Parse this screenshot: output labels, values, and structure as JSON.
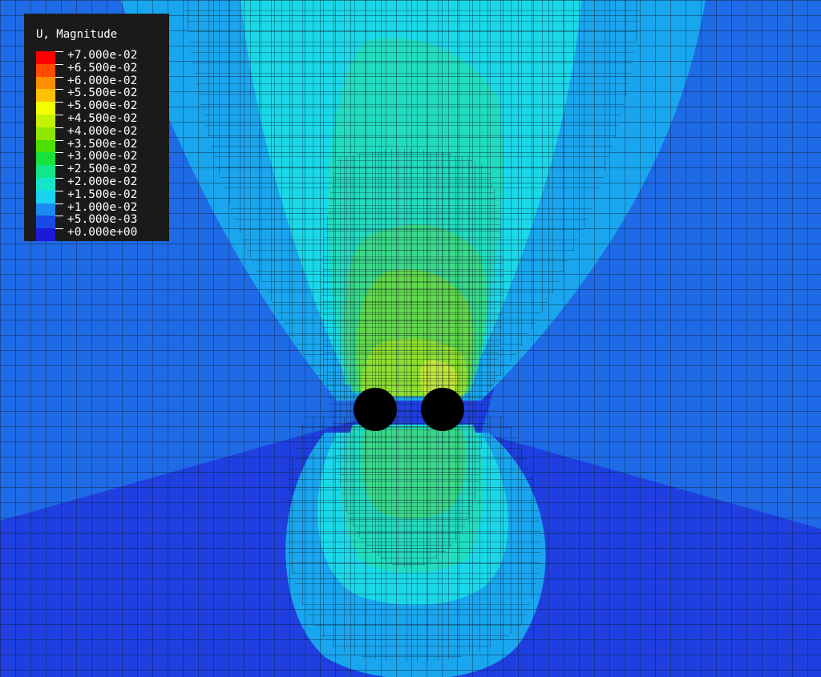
{
  "legend": {
    "title": "U, Magnitude",
    "levels": [
      {
        "label": "+7.000e-02",
        "color": "#ff0000"
      },
      {
        "label": "+6.500e-02",
        "color": "#ff4a00"
      },
      {
        "label": "+6.000e-02",
        "color": "#ff8d00"
      },
      {
        "label": "+5.500e-02",
        "color": "#ffc200"
      },
      {
        "label": "+5.000e-02",
        "color": "#f2ff00"
      },
      {
        "label": "+4.500e-02",
        "color": "#c4f200"
      },
      {
        "label": "+4.000e-02",
        "color": "#8fe600"
      },
      {
        "label": "+3.500e-02",
        "color": "#4ee000"
      },
      {
        "label": "+3.000e-02",
        "color": "#18e23c"
      },
      {
        "label": "+2.500e-02",
        "color": "#12e68a"
      },
      {
        "label": "+2.000e-02",
        "color": "#16e6c8"
      },
      {
        "label": "+1.500e-02",
        "color": "#18d2f2"
      },
      {
        "label": "+1.000e-02",
        "color": "#1a8cf0"
      },
      {
        "label": "+5.000e-03",
        "color": "#1a4ae6"
      },
      {
        "label": "+0.000e+00",
        "color": "#1a1ad8"
      }
    ]
  },
  "contour_colors": {
    "band_0": "#1f3fe0",
    "band_1": "#1f6ae6",
    "band_2": "#1aa6ef",
    "band_3": "#1ad8e8",
    "band_4": "#22dcc0",
    "band_5": "#3ad98a",
    "band_6": "#62d84a",
    "band_7": "#8ee030",
    "band_8": "#c2e63a",
    "mesh_line": "#0a1a2a",
    "holes": "#000000"
  }
}
